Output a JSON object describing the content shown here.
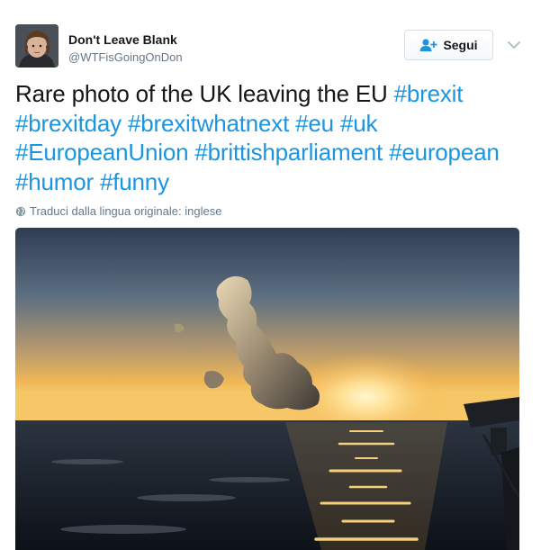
{
  "author": {
    "display_name": "Don't Leave Blank",
    "handle": "@WTFisGoingOnDon"
  },
  "follow_button": {
    "label": "Segui",
    "icon": "add-user-icon"
  },
  "menu": {
    "icon": "chevron-down-icon"
  },
  "tweet": {
    "lead_text": "Rare photo of the UK leaving the EU ",
    "hashtags": [
      "#brexit",
      "#brexitday",
      "#brexitwhatnext",
      "#eu",
      "#uk",
      "#EuropeanUnion",
      "#brittishparliament",
      "#european",
      "#humor",
      "#funny"
    ]
  },
  "translate": {
    "label": "Traduci dalla lingua originale: inglese",
    "icon": "globe-icon"
  },
  "photo": {
    "subject": "sunset over the sea with a UK-shaped cloud"
  },
  "colors": {
    "hashtag": "#1b95e0",
    "secondary_text": "#657786",
    "primary_text": "#14171a"
  }
}
